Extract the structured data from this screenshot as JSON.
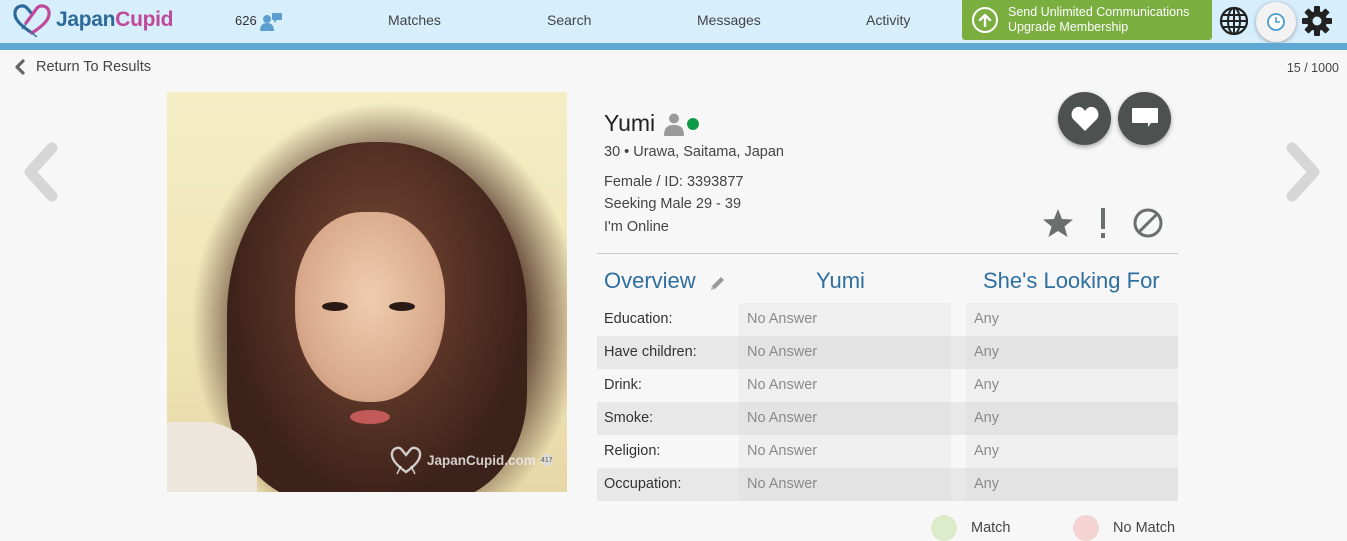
{
  "header": {
    "logo_part1": "Japan",
    "logo_part2": "Cupid",
    "online_count": "626",
    "nav": [
      "Matches",
      "Search",
      "Messages",
      "Activity"
    ],
    "upgrade_line1": "Send Unlimited Communications",
    "upgrade_line2": "Upgrade Membership",
    "icons": [
      "globe-icon",
      "clock-icon",
      "gear-icon"
    ]
  },
  "subbar": {
    "return_label": "Return To Results",
    "pager": "15 / 1000"
  },
  "photo": {
    "watermark": "JapanCupid.com",
    "badge": "417"
  },
  "profile": {
    "name": "Yumi",
    "online": true,
    "status_color": "#0f9a48",
    "age_location": "30 • Urawa, Saitama, Japan",
    "gender_id": "Female / ID: 3393877",
    "seeking": "Seeking Male 29 - 39",
    "online_text": "I'm Online"
  },
  "actions": {
    "primary": [
      "like-heart",
      "message"
    ],
    "secondary": [
      "favorite-star",
      "report",
      "block"
    ]
  },
  "overview": {
    "title": "Overview",
    "col_user": "Yumi",
    "col_looking": "She's Looking For",
    "rows": [
      {
        "label": "Education:",
        "value": "No Answer",
        "looking": "Any"
      },
      {
        "label": "Have children:",
        "value": "No Answer",
        "looking": "Any"
      },
      {
        "label": "Drink:",
        "value": "No Answer",
        "looking": "Any"
      },
      {
        "label": "Smoke:",
        "value": "No Answer",
        "looking": "Any"
      },
      {
        "label": "Religion:",
        "value": "No Answer",
        "looking": "Any"
      },
      {
        "label": "Occupation:",
        "value": "No Answer",
        "looking": "Any"
      }
    ]
  },
  "legend": {
    "match_label": "Match",
    "match_color": "#dcebc9",
    "nomatch_label": "No Match",
    "nomatch_color": "#f5d3d3"
  }
}
